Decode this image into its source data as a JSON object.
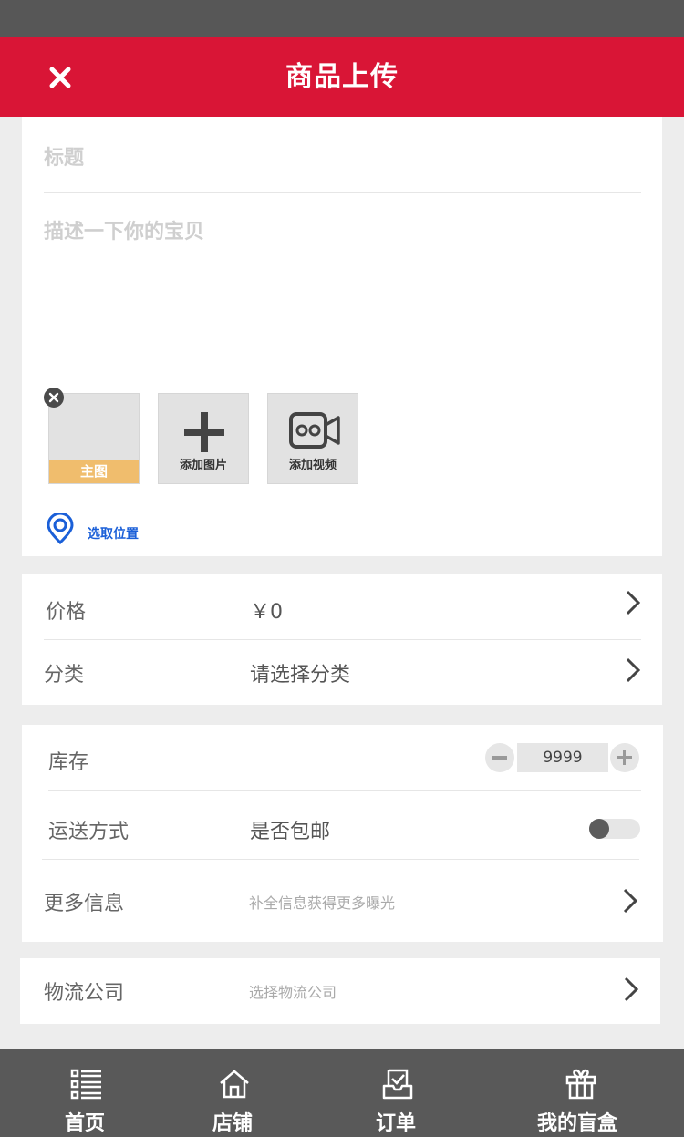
{
  "header": {
    "title": "商品上传",
    "close_icon": "close-icon"
  },
  "form": {
    "title_placeholder": "标题",
    "desc_placeholder": "描述一下你的宝贝",
    "main_image_label": "主图",
    "add_image_label": "添加图片",
    "add_video_label": "添加视频",
    "location_label": "选取位置"
  },
  "price": {
    "label": "价格",
    "value": "￥0"
  },
  "category": {
    "label": "分类",
    "value": "请选择分类"
  },
  "stock": {
    "label": "库存",
    "value": "9999"
  },
  "shipping": {
    "label": "运送方式",
    "value": "是否包邮",
    "free_shipping": false
  },
  "more_info": {
    "label": "更多信息",
    "hint": "补全信息获得更多曝光"
  },
  "logistics": {
    "label": "物流公司",
    "hint": "选择物流公司"
  },
  "tabbar": {
    "items": [
      {
        "label": "首页",
        "icon": "list-icon"
      },
      {
        "label": "店铺",
        "icon": "home-icon"
      },
      {
        "label": "订单",
        "icon": "order-check-icon"
      },
      {
        "label": "我的盲盒",
        "icon": "gift-box-icon"
      }
    ]
  },
  "colors": {
    "header": "#d91536",
    "main_badge": "#f0bd6d",
    "location": "#1a5fd8",
    "tabbar": "#595959"
  }
}
